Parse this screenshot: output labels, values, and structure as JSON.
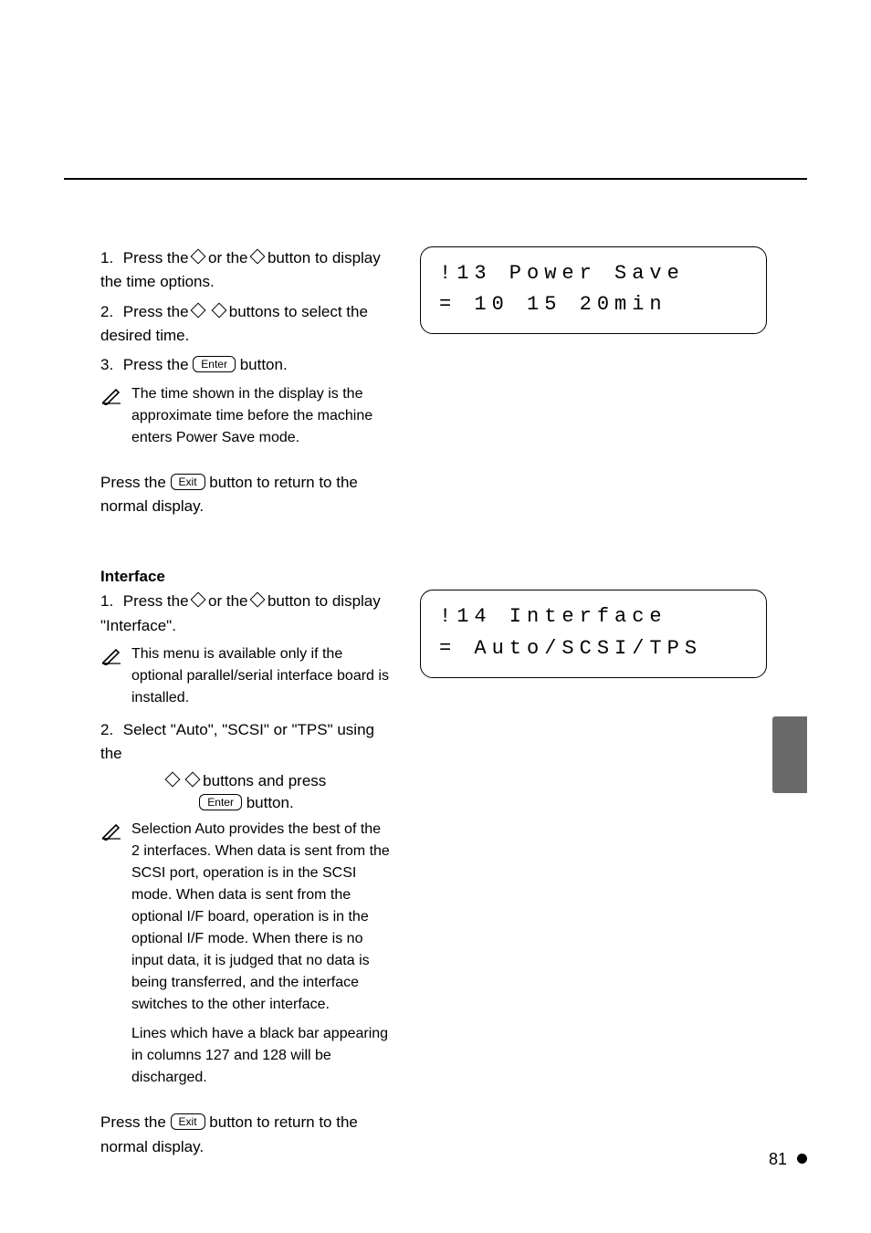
{
  "lcd1": {
    "line1": "!13 Power Save",
    "line2": "=  10  15  20min"
  },
  "lcd2": {
    "line1": "!14 Interface",
    "line2": "= Auto/SCSI/TPS"
  },
  "sec1": {
    "step1a": "Press the ",
    "step1b": " or the ",
    "step1c": " button to display the time options.",
    "step2a": "Press the ",
    "step2b": " buttons to select the desired time.",
    "step3a": "Press the ",
    "step3b": " button.",
    "note1": "The time shown in the display is the approximate time before the machine enters Power Save mode.",
    "exit_a": "Press the ",
    "exit_b": " button to return to the normal display."
  },
  "sec2": {
    "heading": "Interface",
    "step1a": "Press the ",
    "step1b": " or the ",
    "step1c": " button to display \"Interface\".",
    "note1": "This menu is available only if the optional parallel/serial interface board is installed.",
    "step2a": "Select \"Auto\", \"SCSI\" or \"TPS\" using the ",
    "step2b": " buttons and press ",
    "step2c": " button.",
    "note2_p1": "Selection Auto provides the best of the 2 interfaces. When data is sent from the SCSI port, operation is in the SCSI mode. When data is sent from the optional I/F board, operation is in the optional I/F mode. When there is no input data, it is judged that no data is being transferred, and the interface switches to the other interface.",
    "note2_p2": "Lines which have a black bar appearing in columns 127 and 128 will be discharged.",
    "exit_a": "Press the ",
    "exit_b": " button to return to the normal display."
  },
  "keys": {
    "enter": "Enter",
    "exit": "Exit"
  },
  "steps": {
    "s1": "1.",
    "s2": "2.",
    "s3": "3."
  },
  "page_number": "81"
}
